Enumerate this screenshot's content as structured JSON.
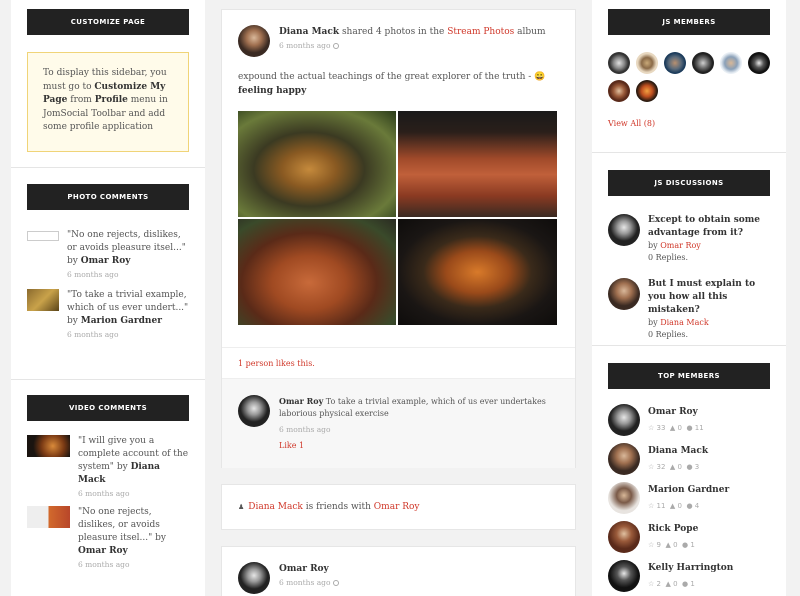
{
  "left": {
    "customize": {
      "title": "CUSTOMIZE PAGE",
      "text_1": "To display this sidebar, you must go to ",
      "text_link1": "Customize My Page",
      "text_2": " from ",
      "text_link2": "Profile",
      "text_3": " menu in JomSocial Toolbar and add some profile application"
    },
    "photo_comments": {
      "title": "PHOTO COMMENTS",
      "items": [
        {
          "quote": "\"No one rejects, dislikes, or avoids pleasure itsel...\"",
          "by": "by",
          "author": "Omar Roy",
          "time": "6 months ago"
        },
        {
          "quote": "\"To take a trivial example, which of us ever undert...\"",
          "by": "by",
          "author": "Marion Gardner",
          "time": "6 months ago"
        }
      ]
    },
    "video_comments": {
      "title": "VIDEO COMMENTS",
      "items": [
        {
          "quote": "\"I will give you a complete account of the system\"",
          "by": "by",
          "author": "Diana Mack",
          "time": "6 months ago"
        },
        {
          "quote": "\"No one rejects, dislikes, or avoids pleasure itsel...\"",
          "by": "by",
          "author": "Omar Roy",
          "time": "6 months ago"
        }
      ]
    }
  },
  "stream": {
    "post1": {
      "author": "Diana Mack",
      "action": " shared 4 photos in the ",
      "album": "Stream Photos",
      "suffix": " album",
      "time": "6 months ago",
      "body": "expound the actual teachings of the great explorer of the truth - ",
      "emoji": "😀",
      "feeling": "feeling happy",
      "likes": "1 person likes this.",
      "comment": {
        "author": "Omar Roy",
        "text": " To take a trivial example, which of us ever undertakes laborious physical exercise",
        "time": "6 months ago",
        "like": "Like 1"
      }
    },
    "friends": {
      "a": "Diana Mack",
      "mid": " is friends with ",
      "b": "Omar Roy"
    },
    "post3": {
      "author": "Omar Roy",
      "time": "6 months ago"
    }
  },
  "right": {
    "members": {
      "title": "JS MEMBERS",
      "view_all": "View All (8)"
    },
    "discussions": {
      "title": "JS DISCUSSIONS",
      "items": [
        {
          "title": "Except to obtain some advantage from it?",
          "by": "by",
          "author": "Omar Roy",
          "replies": "0 Replies."
        },
        {
          "title": "But I must explain to you how all this mistaken?",
          "by": "by",
          "author": "Diana Mack",
          "replies": "0 Replies."
        }
      ]
    },
    "top_members": {
      "title": "TOP MEMBERS",
      "items": [
        {
          "name": "Omar Roy",
          "s1": "33",
          "s2": "0",
          "s3": "11"
        },
        {
          "name": "Diana Mack",
          "s1": "32",
          "s2": "0",
          "s3": "3"
        },
        {
          "name": "Marion Gardner",
          "s1": "11",
          "s2": "0",
          "s3": "4"
        },
        {
          "name": "Rick Pope",
          "s1": "9",
          "s2": "0",
          "s3": "1"
        },
        {
          "name": "Kelly Harrington",
          "s1": "2",
          "s2": "0",
          "s3": "1"
        }
      ]
    }
  }
}
